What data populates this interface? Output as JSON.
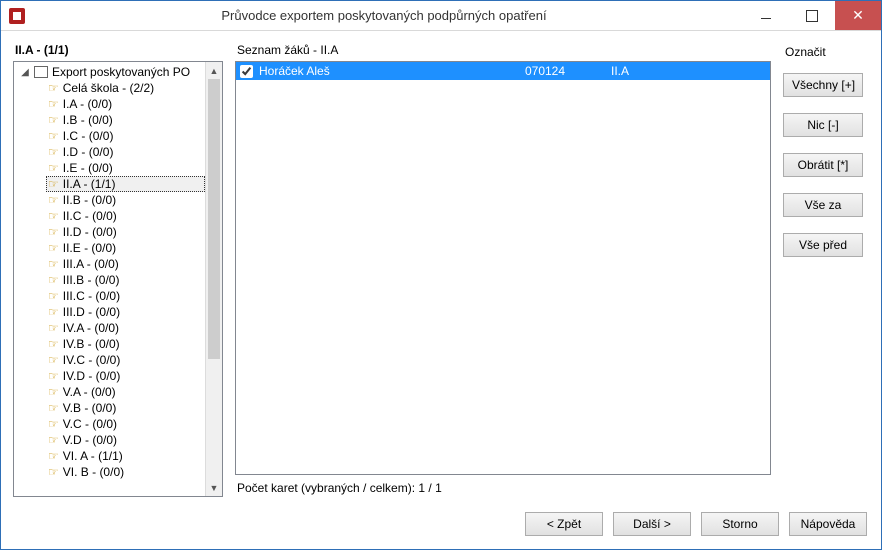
{
  "window": {
    "title": "Průvodce exportem poskytovaných podpůrných opatření"
  },
  "left": {
    "heading": "II.A -  (1/1)",
    "root_label": "Export poskytovaných PO",
    "items": [
      {
        "label": "Celá škola -  (2/2)"
      },
      {
        "label": "I.A -  (0/0)"
      },
      {
        "label": "I.B -  (0/0)"
      },
      {
        "label": "I.C -  (0/0)"
      },
      {
        "label": "I.D -  (0/0)"
      },
      {
        "label": "I.E -  (0/0)"
      },
      {
        "label": "II.A -  (1/1)",
        "selected": true
      },
      {
        "label": "II.B -  (0/0)"
      },
      {
        "label": "II.C -  (0/0)"
      },
      {
        "label": "II.D -  (0/0)"
      },
      {
        "label": "II.E -  (0/0)"
      },
      {
        "label": "III.A -  (0/0)"
      },
      {
        "label": "III.B -  (0/0)"
      },
      {
        "label": "III.C -  (0/0)"
      },
      {
        "label": "III.D -  (0/0)"
      },
      {
        "label": "IV.A -  (0/0)"
      },
      {
        "label": "IV.B -  (0/0)"
      },
      {
        "label": "IV.C -  (0/0)"
      },
      {
        "label": "IV.D -  (0/0)"
      },
      {
        "label": "V.A -  (0/0)"
      },
      {
        "label": "V.B -  (0/0)"
      },
      {
        "label": "V.C -  (0/0)"
      },
      {
        "label": "V.D -  (0/0)"
      },
      {
        "label": "VI. A -  (1/1)"
      },
      {
        "label": "VI. B -  (0/0)"
      }
    ]
  },
  "mid": {
    "heading": "Seznam žáků - II.A",
    "rows": [
      {
        "checked": true,
        "name": "Horáček Aleš",
        "id": "070124",
        "class": "II.A"
      }
    ],
    "count_line": "Počet karet (vybraných / celkem): 1 / 1"
  },
  "right": {
    "heading": "Označit",
    "buttons": {
      "all": "Všechny [+]",
      "none": "Nic [-]",
      "invert": "Obrátit [*]",
      "after": "Vše za",
      "before": "Vše před"
    }
  },
  "footer": {
    "back": "<  Zpět",
    "next": "Další  >",
    "cancel": "Storno",
    "help": "Nápověda"
  }
}
